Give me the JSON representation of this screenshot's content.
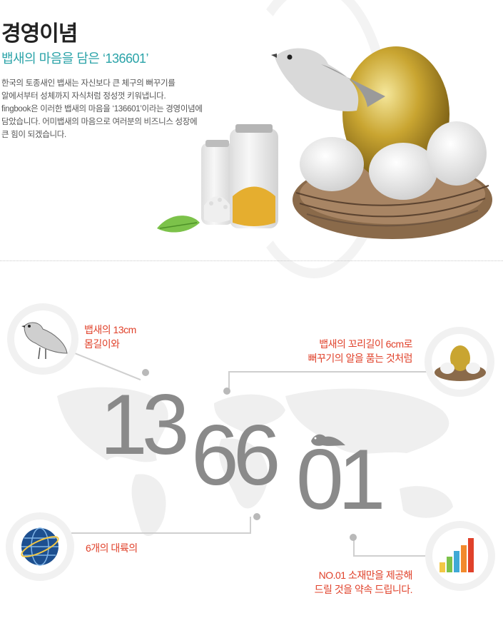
{
  "header": {
    "title": "경영이념",
    "subtitle": "뱁새의 마음을 담은 ‘136601’",
    "description_lines": [
      "한국의 토종새인 뱁새는 자신보다 큰 체구의 뻐꾸기를",
      "알에서부터 성체까지 자식처럼 정성껏 키워냅니다.",
      "fingbook은 이러한 뱁새의 마음을 ‘136601’이라는 경영이념에",
      "담았습니다. 어미뱁새의 마음으로 여러분의 비즈니스 성장에",
      "큰 힘이 되겠습니다."
    ]
  },
  "concept": {
    "number": "136601",
    "labels": {
      "top_left": [
        "뱁새의 13cm",
        "몸길이와"
      ],
      "top_right": [
        "뱁새의 꼬리길이 6cm로",
        "뻐꾸기의 알을 품는 것처럼"
      ],
      "bottom_left": [
        "6개의 대륙의"
      ],
      "bottom_right": [
        "NO.01 소재만을 제공해",
        "드릴 것을 약속 드립니다."
      ]
    },
    "icons": {
      "top_left": "bird-icon",
      "top_right": "golden-egg-nest-icon",
      "bottom_left": "globe-icon",
      "bottom_right": "bar-chart-icon"
    },
    "colors": {
      "label": "#e0412a",
      "accent": "#2aa3a8",
      "number": "#8a8a8a"
    }
  }
}
